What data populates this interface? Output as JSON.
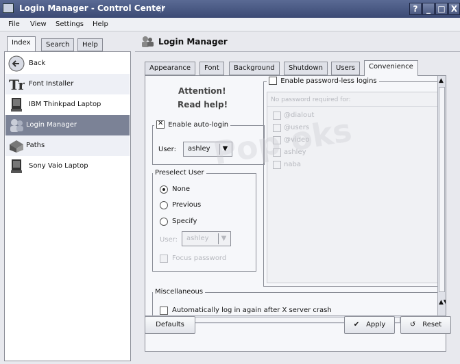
{
  "window": {
    "title": "Login Manager - Control Center",
    "buttons": [
      "?",
      "_",
      "□",
      "X"
    ]
  },
  "menu": [
    "File",
    "View",
    "Settings",
    "Help"
  ],
  "left_tabs": [
    "Index",
    "Search",
    "Help"
  ],
  "left_list": [
    {
      "label": "Back",
      "icon": "back-arrow-icon"
    },
    {
      "label": "Font Installer",
      "icon": "font-installer-icon"
    },
    {
      "label": "IBM Thinkpad Laptop",
      "icon": "laptop-icon"
    },
    {
      "label": "Login Manager",
      "icon": "login-manager-icon"
    },
    {
      "label": "Paths",
      "icon": "paths-icon"
    },
    {
      "label": "Sony Vaio Laptop",
      "icon": "laptop-icon"
    }
  ],
  "module_header": "Login Manager",
  "tabs": [
    "Appearance",
    "Font",
    "Background",
    "Shutdown",
    "Users",
    "Convenience"
  ],
  "attention": {
    "line1": "Attention!",
    "line2": "Read help!"
  },
  "autologin": {
    "label": "Enable auto-login",
    "user_label": "User:",
    "user_value": "ashley"
  },
  "preselect": {
    "group_label": "Preselect User",
    "options": [
      "None",
      "Previous",
      "Specify"
    ],
    "user_label": "User:",
    "user_value": "ashley",
    "focus_password": "Focus password"
  },
  "passwordless": {
    "label": "Enable password-less logins",
    "subheader": "No password required for:",
    "items": [
      "@dialout",
      "@users",
      "@video",
      "ashley",
      "naba"
    ]
  },
  "misc": {
    "group_label": "Miscellaneous",
    "auto_relogin": "Automatically log in again after X server crash"
  },
  "buttons": {
    "defaults": "Defaults",
    "apply": "Apply",
    "reset": "Reset"
  },
  "watermark": "Pop   oks",
  "colors": {
    "title_bar": "#3b4a74",
    "selected_item": "#7b8296"
  }
}
